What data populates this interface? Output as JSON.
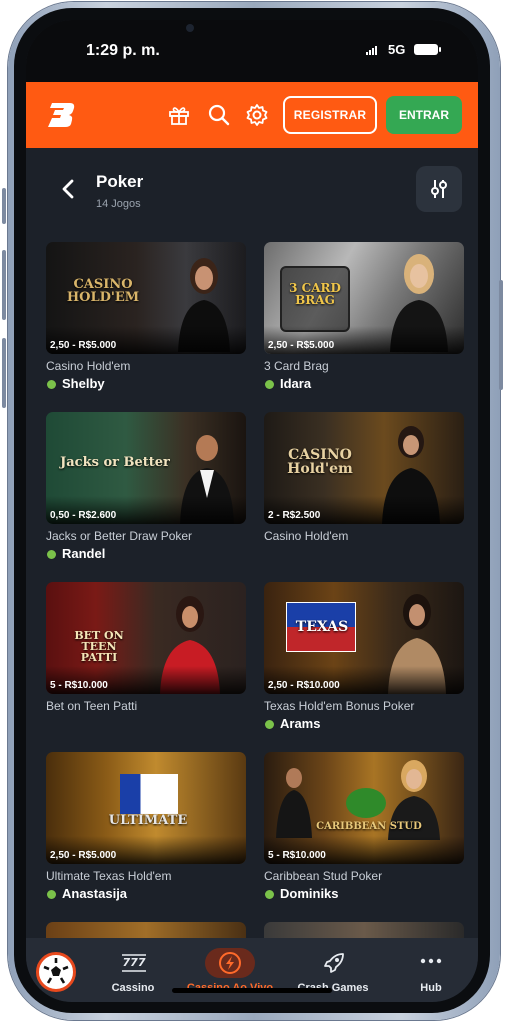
{
  "status_bar": {
    "time": "1:29 p. m.",
    "network": "5G"
  },
  "header": {
    "register_label": "REGISTRAR",
    "login_label": "ENTRAR"
  },
  "page": {
    "title": "Poker",
    "subtitle": "14 Jogos"
  },
  "games": [
    {
      "limit": "2,50 - R$5.000",
      "name": "Casino Hold'em",
      "dealer": "Shelby",
      "art": "CASINO HOLD'EM"
    },
    {
      "limit": "2,50 - R$5.000",
      "name": "3 Card Brag",
      "dealer": "Idara",
      "art": "3 CARD BRAG"
    },
    {
      "limit": "0,50 - R$2.600",
      "name": "Jacks or Better Draw Poker",
      "dealer": "Randel",
      "art": "Jacks or Better"
    },
    {
      "limit": "2 - R$2.500",
      "name": "Casino Hold'em",
      "dealer": "",
      "art": "CASINO Hold'em"
    },
    {
      "limit": "5 - R$10.000",
      "name": "Bet on Teen Patti",
      "dealer": "",
      "art": "BET ON TEEN PATTI"
    },
    {
      "limit": "2,50 - R$10.000",
      "name": "Texas Hold'em Bonus Poker",
      "dealer": "Arams",
      "art": "TEXAS"
    },
    {
      "limit": "2,50 - R$5.000",
      "name": "Ultimate Texas Hold'em",
      "dealer": "Anastasija",
      "art": "ULTIMATE"
    },
    {
      "limit": "5 - R$10.000",
      "name": "Caribbean Stud Poker",
      "dealer": "Dominiks",
      "art": "CARIBBEAN STUD"
    }
  ],
  "bottom_nav": [
    {
      "label": "",
      "icon": "soccer-ball-icon"
    },
    {
      "label": "Cassino",
      "icon": "slot-777-icon"
    },
    {
      "label": "Cassino Ao Vivo",
      "icon": "live-casino-icon"
    },
    {
      "label": "Crash Games",
      "icon": "rocket-icon"
    },
    {
      "label": "Hub",
      "icon": "more-dots-icon"
    }
  ],
  "colors": {
    "brand": "#ff5a12",
    "login": "#34a853",
    "background": "#1c2129",
    "online": "#7bc24a"
  }
}
